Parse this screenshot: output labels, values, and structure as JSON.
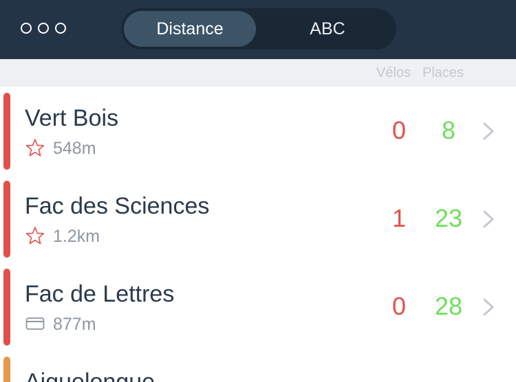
{
  "header": {
    "tabs": [
      {
        "label": "Distance",
        "active": true
      },
      {
        "label": "ABC",
        "active": false
      }
    ]
  },
  "columns": {
    "velos": "Vélos",
    "places": "Places"
  },
  "stations": [
    {
      "name": "Vert Bois",
      "distance": "548m",
      "bikes": "0",
      "places": "8",
      "icon": "star-icon",
      "bar_color": "#e0504a"
    },
    {
      "name": "Fac des Sciences",
      "distance": "1.2km",
      "bikes": "1",
      "places": "23",
      "icon": "star-icon",
      "bar_color": "#e0504a"
    },
    {
      "name": "Fac de Lettres",
      "distance": "877m",
      "bikes": "0",
      "places": "28",
      "icon": "card-icon",
      "bar_color": "#e0504a"
    },
    {
      "name": "Aiguelongue",
      "bar_color": "#e8984a"
    }
  ],
  "colors": {
    "header_bg": "#243447",
    "bikes_text": "#e0504a",
    "places_text": "#6fde5c"
  }
}
